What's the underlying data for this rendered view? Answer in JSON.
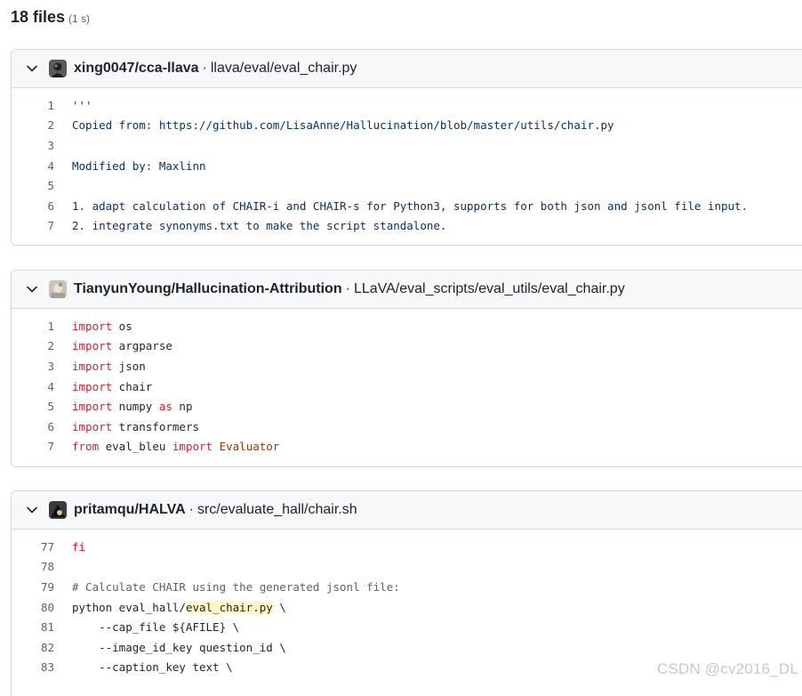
{
  "summary": {
    "count_label": "18 files",
    "time_label": "(1 s)"
  },
  "results": [
    {
      "repo": "xing0047/cca-llava",
      "separator": "·",
      "path": "llava/eval/eval_chair.py",
      "avatar_icon": "user-avatar-dark",
      "lines": [
        {
          "num": "1",
          "tokens": [
            {
              "t": "'''",
              "c": "str"
            }
          ]
        },
        {
          "num": "2",
          "tokens": [
            {
              "t": "Copied from: https://github.com/LisaAnne/Hallucination/blob/master/utils/chair.py",
              "c": "str"
            }
          ]
        },
        {
          "num": "3",
          "tokens": []
        },
        {
          "num": "4",
          "tokens": [
            {
              "t": "Modified by: Maxlinn",
              "c": "str"
            }
          ]
        },
        {
          "num": "5",
          "tokens": []
        },
        {
          "num": "6",
          "tokens": [
            {
              "t": "1. adapt calculation of CHAIR-i and CHAIR-s for Python3, supports for both json and jsonl file input.",
              "c": "str"
            }
          ]
        },
        {
          "num": "7",
          "tokens": [
            {
              "t": "2. integrate synonyms.txt to make the script standalone.",
              "c": "str"
            }
          ]
        }
      ]
    },
    {
      "repo": "TianyunYoung/Hallucination-Attribution",
      "separator": "·",
      "path": "LLaVA/eval_scripts/eval_utils/eval_chair.py",
      "avatar_icon": "user-avatar-light",
      "lines": [
        {
          "num": "1",
          "tokens": [
            {
              "t": "import",
              "c": "kw"
            },
            {
              "t": " os",
              "c": "txt"
            }
          ]
        },
        {
          "num": "2",
          "tokens": [
            {
              "t": "import",
              "c": "kw"
            },
            {
              "t": " argparse",
              "c": "txt"
            }
          ]
        },
        {
          "num": "3",
          "tokens": [
            {
              "t": "import",
              "c": "kw"
            },
            {
              "t": " json",
              "c": "txt"
            }
          ]
        },
        {
          "num": "4",
          "tokens": [
            {
              "t": "import",
              "c": "kw"
            },
            {
              "t": " chair",
              "c": "txt"
            }
          ]
        },
        {
          "num": "5",
          "tokens": [
            {
              "t": "import",
              "c": "kw"
            },
            {
              "t": " numpy ",
              "c": "txt"
            },
            {
              "t": "as",
              "c": "kw"
            },
            {
              "t": " np",
              "c": "txt"
            }
          ]
        },
        {
          "num": "6",
          "tokens": [
            {
              "t": "import",
              "c": "kw"
            },
            {
              "t": " transformers",
              "c": "txt"
            }
          ]
        },
        {
          "num": "7",
          "tokens": [
            {
              "t": "from",
              "c": "kw"
            },
            {
              "t": " eval_bleu ",
              "c": "txt"
            },
            {
              "t": "import",
              "c": "kw"
            },
            {
              "t": " Evaluator",
              "c": "cls"
            }
          ]
        }
      ]
    },
    {
      "repo": "pritamqu/HALVA",
      "separator": "·",
      "path": "src/evaluate_hall/chair.sh",
      "avatar_icon": "user-avatar-dark",
      "lines": [
        {
          "num": "77",
          "tokens": [
            {
              "t": "fi",
              "c": "kw"
            }
          ]
        },
        {
          "num": "78",
          "tokens": []
        },
        {
          "num": "79",
          "tokens": [
            {
              "t": "# Calculate CHAIR using the generated jsonl file:",
              "c": "cmt"
            }
          ]
        },
        {
          "num": "80",
          "tokens": [
            {
              "t": "python eval_hall/",
              "c": "txt"
            },
            {
              "t": "eval_chair.py",
              "c": "txt",
              "hl": true
            },
            {
              "t": " \\",
              "c": "txt"
            }
          ]
        },
        {
          "num": "81",
          "tokens": [
            {
              "t": "    --cap_file ${AFILE} \\",
              "c": "txt"
            }
          ]
        },
        {
          "num": "82",
          "tokens": [
            {
              "t": "    --image_id_key question_id \\",
              "c": "txt"
            }
          ]
        },
        {
          "num": "83",
          "tokens": [
            {
              "t": "    --caption_key text \\",
              "c": "txt"
            }
          ]
        }
      ]
    }
  ],
  "watermark": "CSDN @cv2016_DL",
  "colors": {
    "keyword": "#cf222e",
    "string": "#0a3069",
    "class": "#953800",
    "comment": "#59636e",
    "highlight": "#fff8c5"
  }
}
